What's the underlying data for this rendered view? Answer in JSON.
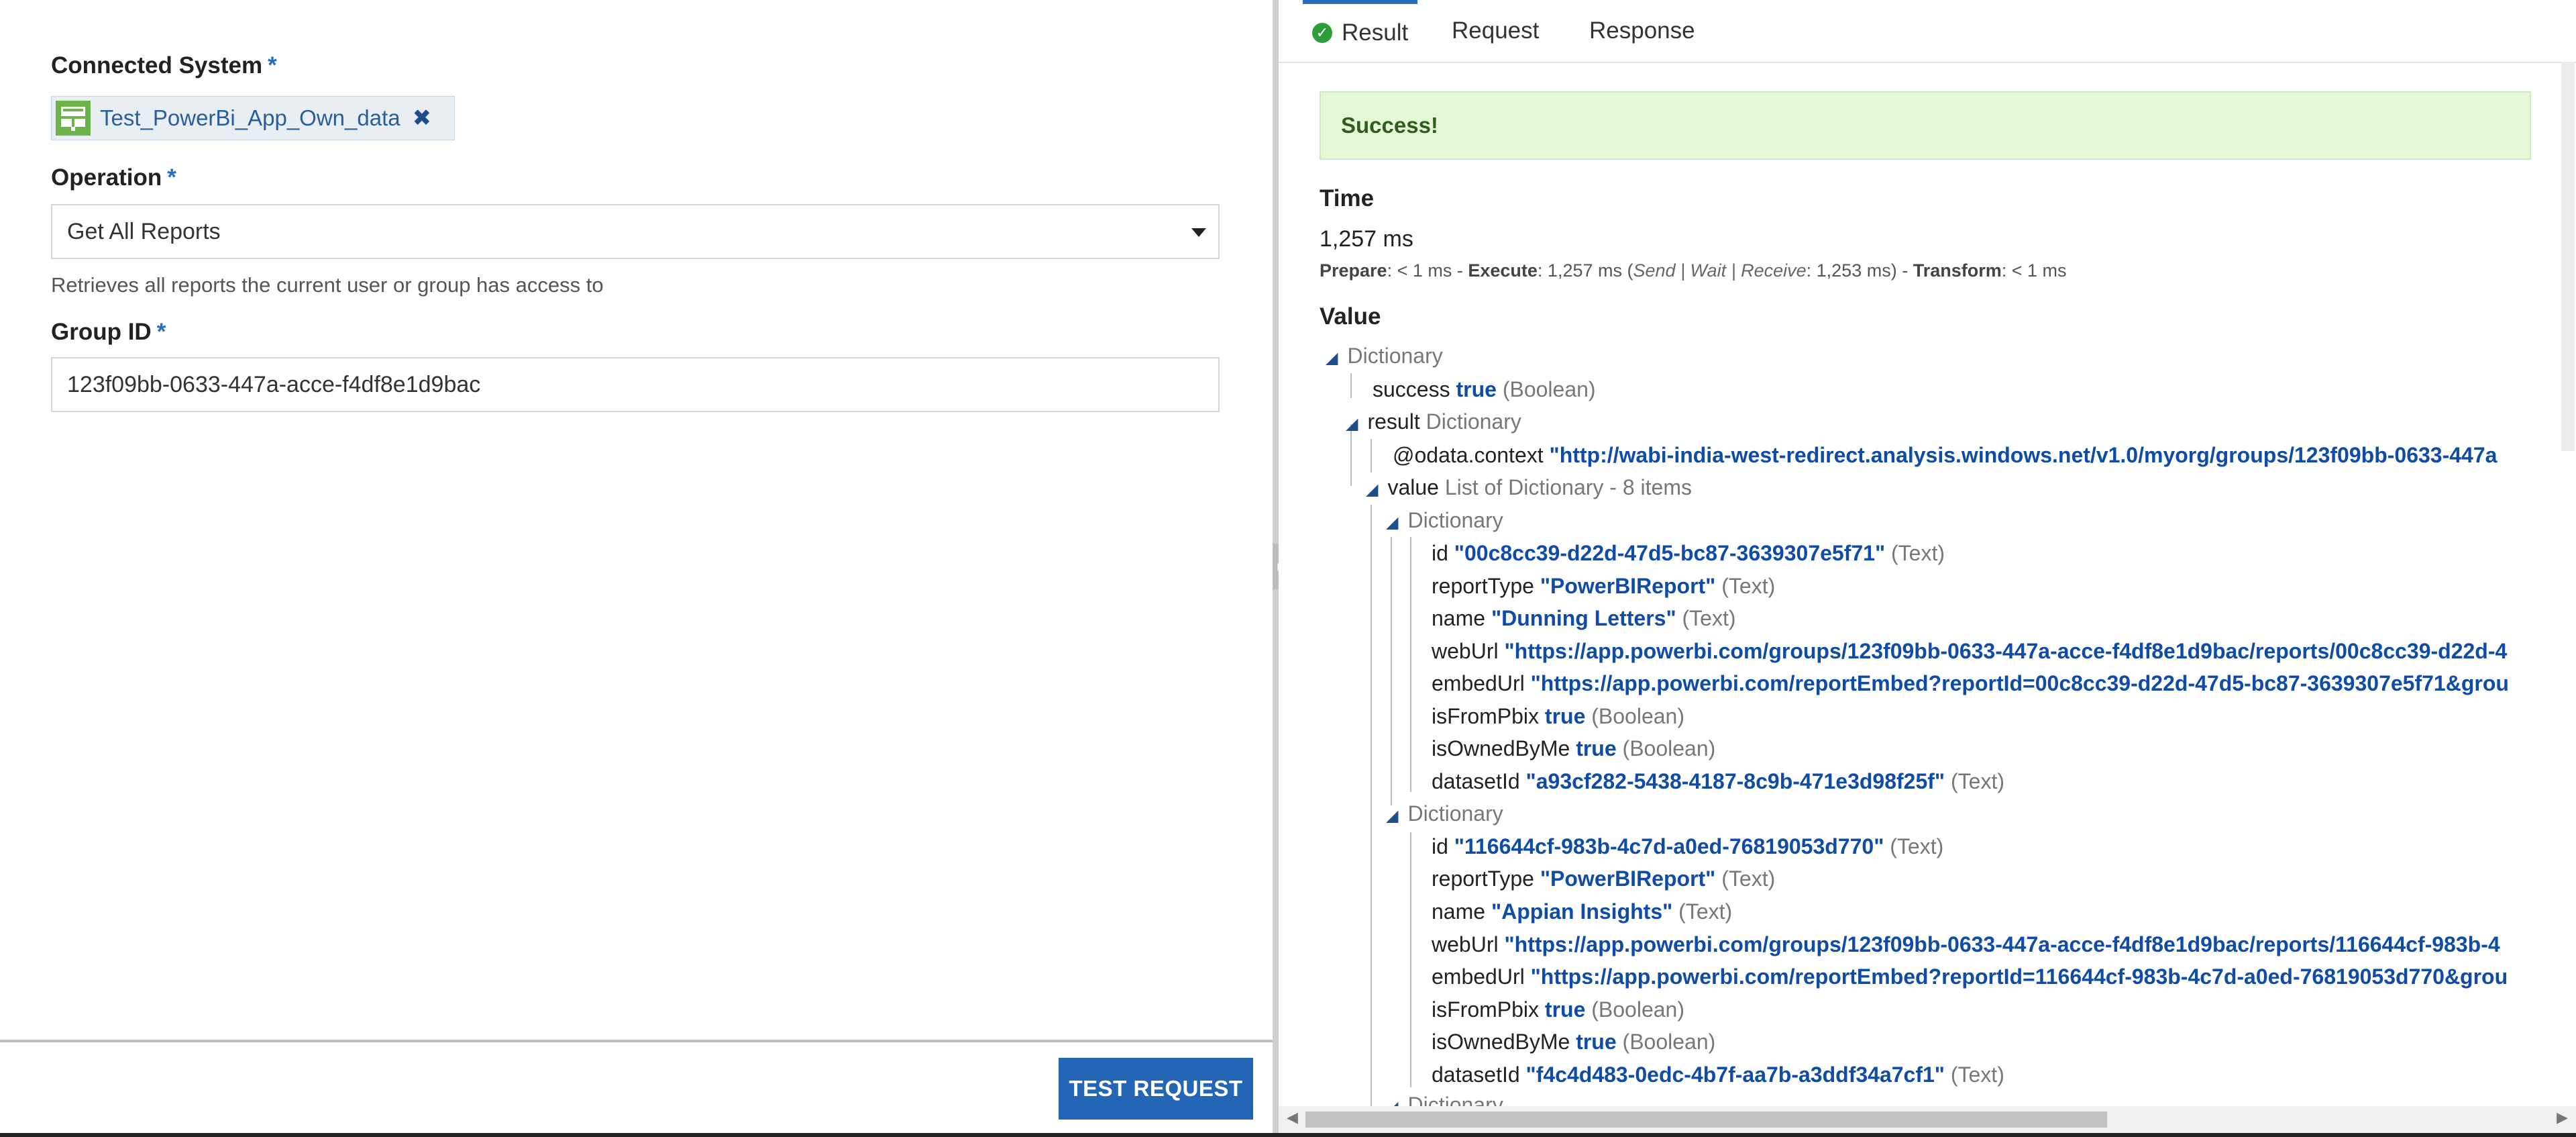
{
  "left": {
    "connected_system": {
      "label": "Connected System",
      "required_mark": "*",
      "chip_text": "Test_PowerBi_App_Own_data",
      "remove_glyph": "✖"
    },
    "operation": {
      "label": "Operation",
      "required_mark": "*",
      "selected": "Get All Reports",
      "description": "Retrieves all reports the current user or group has access to"
    },
    "group_id": {
      "label": "Group ID",
      "required_mark": "*",
      "value": "123f09bb-0633-447a-acce-f4df8e1d9bac"
    },
    "test_button": "TEST REQUEST"
  },
  "right": {
    "tabs": [
      "Result",
      "Request",
      "Response"
    ],
    "success_message": "Success!",
    "time": {
      "heading": "Time",
      "value": "1,257 ms",
      "prepare_label": "Prepare",
      "prepare_value": ": < 1 ms - ",
      "execute_label": "Execute",
      "execute_value": ": 1,257 ms (",
      "execute_detail": "Send | Wait | Receive",
      "execute_detail_value": ": 1,253 ms) - ",
      "transform_label": "Transform",
      "transform_value": ": < 1 ms"
    },
    "value_heading": "Value",
    "tree": {
      "root_type": "Dictionary",
      "success_key": "success",
      "success_val": "true",
      "success_type": "(Boolean)",
      "result_key": "result",
      "result_type": "Dictionary",
      "context_key": "@odata.context",
      "context_val": "\"http://wabi-india-west-redirect.analysis.windows.net/v1.0/myorg/groups/123f09bb-0633-447a",
      "value_key": "value",
      "value_type": "List of Dictionary - 8 items",
      "items": [
        {
          "type": "Dictionary",
          "id": "\"00c8cc39-d22d-47d5-bc87-3639307e5f71\"",
          "reportType": "\"PowerBIReport\"",
          "name": "\"Dunning Letters\"",
          "webUrl": "\"https://app.powerbi.com/groups/123f09bb-0633-447a-acce-f4df8e1d9bac/reports/00c8cc39-d22d-4",
          "embedUrl": "\"https://app.powerbi.com/reportEmbed?reportId=00c8cc39-d22d-47d5-bc87-3639307e5f71&grou",
          "isFromPbix": "true",
          "isOwnedByMe": "true",
          "datasetId": "\"a93cf282-5438-4187-8c9b-471e3d98f25f\""
        },
        {
          "type": "Dictionary",
          "id": "\"116644cf-983b-4c7d-a0ed-76819053d770\"",
          "reportType": "\"PowerBIReport\"",
          "name": "\"Appian Insights\"",
          "webUrl": "\"https://app.powerbi.com/groups/123f09bb-0633-447a-acce-f4df8e1d9bac/reports/116644cf-983b-4",
          "embedUrl": "\"https://app.powerbi.com/reportEmbed?reportId=116644cf-983b-4c7d-a0ed-76819053d770&grou",
          "isFromPbix": "true",
          "isOwnedByMe": "true",
          "datasetId": "\"f4c4d483-0edc-4b7f-aa7b-a3ddf34a7cf1\""
        }
      ],
      "labels": {
        "id": "id",
        "reportType": "reportType",
        "name": "name",
        "webUrl": "webUrl",
        "embedUrl": "embedUrl",
        "isFromPbix": "isFromPbix",
        "isOwnedByMe": "isOwnedByMe",
        "datasetId": "datasetId",
        "text_type": "(Text)",
        "bool_type": "(Boolean)"
      },
      "partial_next": "Dictionary"
    }
  },
  "icons": {
    "expand": "◢",
    "check": "✓",
    "collapse_arrow": "⇤"
  },
  "colors": {
    "accent": "#2a6ebb",
    "button": "#2366b5",
    "success_bg": "#e4f8d8",
    "value_blue": "#0e4ca8"
  }
}
